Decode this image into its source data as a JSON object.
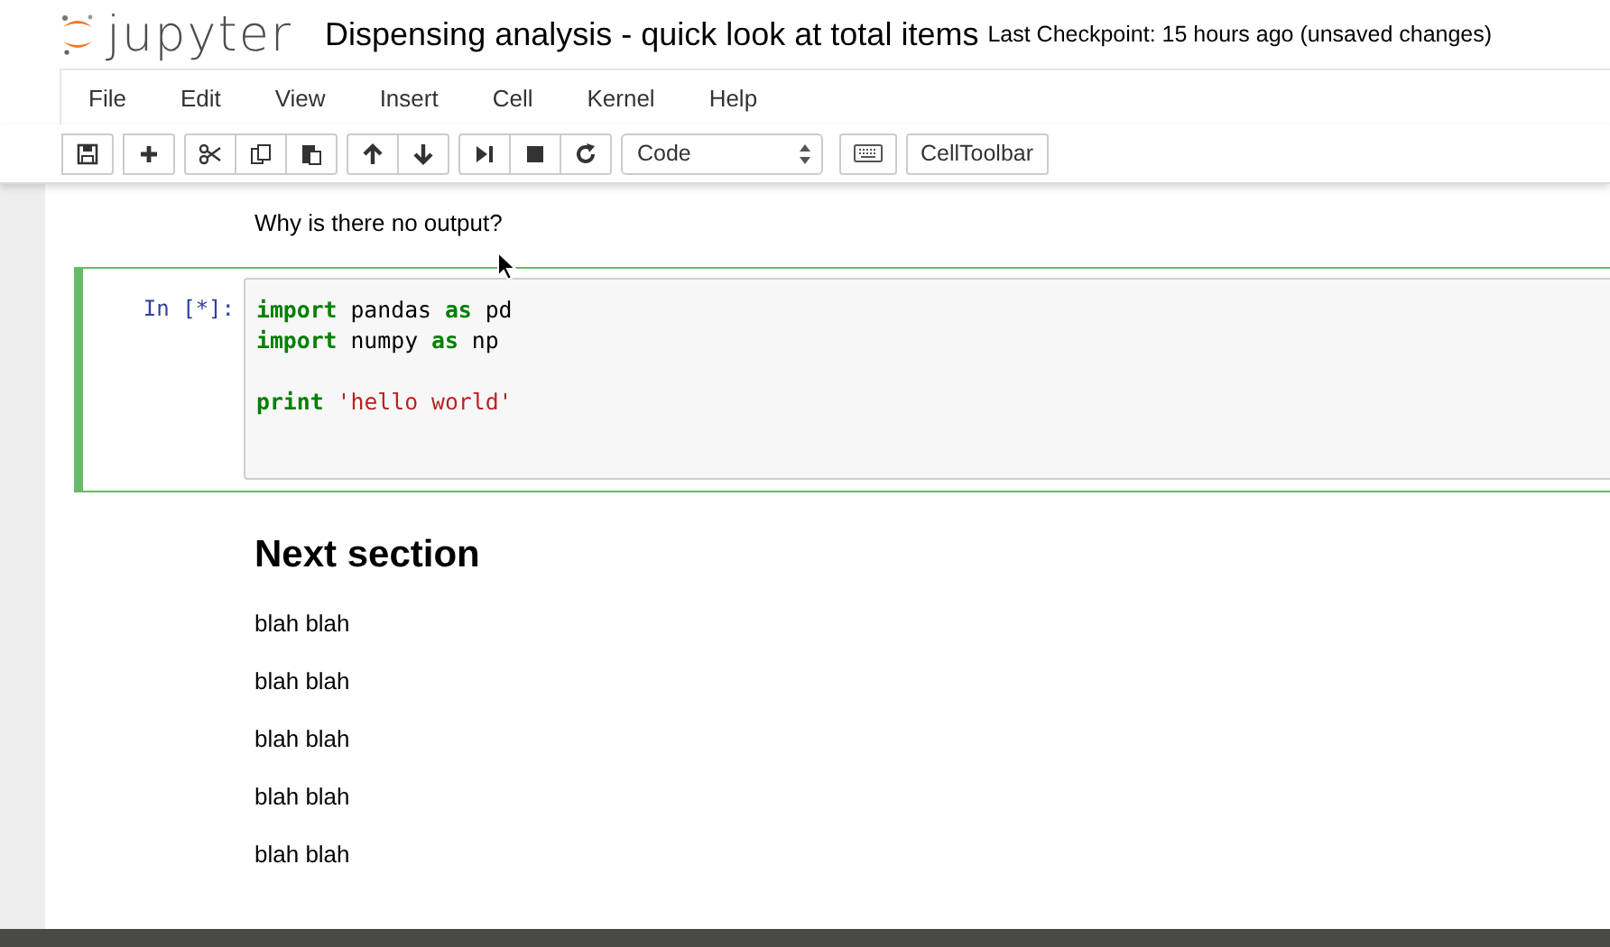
{
  "header": {
    "logo_text": "jupyter",
    "notebook_title": "Dispensing analysis - quick look at total items",
    "checkpoint": "Last Checkpoint: 15 hours ago (unsaved changes)"
  },
  "menu": [
    "File",
    "Edit",
    "View",
    "Insert",
    "Cell",
    "Kernel",
    "Help"
  ],
  "toolbar": {
    "groups": [
      [
        {
          "kind": "save"
        }
      ],
      [
        {
          "kind": "plus"
        }
      ],
      [
        {
          "kind": "cut"
        },
        {
          "kind": "copy"
        },
        {
          "kind": "paste"
        }
      ],
      [
        {
          "kind": "up"
        },
        {
          "kind": "down"
        }
      ],
      [
        {
          "kind": "step"
        },
        {
          "kind": "stop"
        },
        {
          "kind": "restart"
        }
      ]
    ],
    "cell_type": "Code",
    "celltoolbar": "CellToolbar"
  },
  "cells": [
    {
      "kind": "markdown",
      "text": "Why is there no output?"
    },
    {
      "kind": "code",
      "selected": true,
      "prompt": "In [*]:",
      "lines": [
        {
          "tokens": [
            {
              "kind": "keyword",
              "text": "import"
            },
            {
              "kind": "plain",
              "text": " pandas "
            },
            {
              "kind": "keyword",
              "text": "as"
            },
            {
              "kind": "plain",
              "text": " pd"
            }
          ]
        },
        {
          "tokens": [
            {
              "kind": "keyword",
              "text": "import"
            },
            {
              "kind": "plain",
              "text": " numpy "
            },
            {
              "kind": "keyword",
              "text": "as"
            },
            {
              "kind": "plain",
              "text": " np"
            }
          ]
        },
        {
          "gap_before": true,
          "tokens": [
            {
              "kind": "keyword",
              "text": "print"
            },
            {
              "kind": "string",
              "text": " 'hello world'"
            }
          ]
        }
      ]
    },
    {
      "kind": "heading",
      "text": "Next section"
    },
    {
      "kind": "markdown",
      "text": "blah blah"
    },
    {
      "kind": "markdown",
      "text": "blah blah"
    },
    {
      "kind": "markdown",
      "text": "blah blah"
    },
    {
      "kind": "markdown",
      "text": "blah blah"
    },
    {
      "kind": "markdown",
      "text": "blah blah"
    }
  ]
}
